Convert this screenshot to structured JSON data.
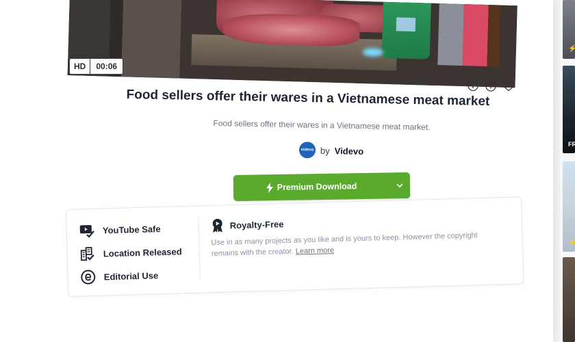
{
  "video": {
    "quality_badge": "HD",
    "duration": "00:06"
  },
  "clip": {
    "title": "Food sellers offer their wares in a Vietnamese meat market",
    "description": "Food sellers offer their wares in a Vietnamese meat market.",
    "author_prefix": "by",
    "author_name": "Videvo",
    "author_logo_text": "videvo"
  },
  "download": {
    "label": "Premium Download",
    "accent": "#5aaa2e"
  },
  "license": {
    "features": [
      {
        "label": "YouTube Safe",
        "icon": "youtube-check-icon"
      },
      {
        "label": "Location Released",
        "icon": "buildings-check-icon"
      },
      {
        "label": "Editorial Use",
        "icon": "editorial-e-icon"
      }
    ],
    "royalty_title": "Royalty-Free",
    "royalty_text": "Use in as many projects as you like and is yours to keep. However the copyright remains with the creator.",
    "learn_more": "Learn more"
  },
  "sidebar_thumb_label": "FR"
}
